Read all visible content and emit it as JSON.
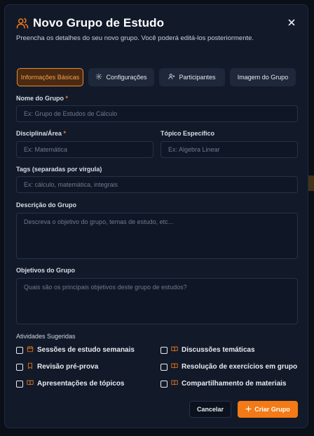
{
  "modal": {
    "title": "Novo Grupo de Estudo",
    "subtitle": "Preencha os detalhes do seu novo grupo. Você poderá editá-los posteriormente.",
    "accent_color": "#f37a16"
  },
  "tabs": [
    {
      "label": "Informações Básicas",
      "icon": "none",
      "active": true
    },
    {
      "label": "Configurações",
      "icon": "gear-icon",
      "active": false
    },
    {
      "label": "Participantes",
      "icon": "user-plus-icon",
      "active": false
    },
    {
      "label": "Imagem do Grupo",
      "icon": "none",
      "active": false
    }
  ],
  "fields": {
    "group_name": {
      "label": "Nome do Grupo",
      "required_mark": "*",
      "placeholder": "Ex: Grupo de Estudos de Cálculo",
      "value": ""
    },
    "discipline": {
      "label": "Disciplina/Área",
      "required_mark": "*",
      "placeholder": "Ex: Matemática",
      "value": ""
    },
    "topic": {
      "label": "Tópico Específico",
      "placeholder": "Ex: Algebra Linear",
      "value": ""
    },
    "tags": {
      "label": "Tags (separadas por vírgula)",
      "placeholder": "Ex: cálculo, matemática, integrais",
      "value": ""
    },
    "description": {
      "label": "Descrição do Grupo",
      "placeholder": "Descreva o objetivo do grupo, temas de estudo, etc...",
      "value": ""
    },
    "objectives": {
      "label": "Objetivos do Grupo",
      "placeholder": "Quais são os principais objetivos deste grupo de estudos?",
      "value": ""
    }
  },
  "activities": {
    "label": "Atividades Sugeridas",
    "items": [
      {
        "label": "Sessões de estudo semanais",
        "icon": "calendar-icon",
        "checked": false
      },
      {
        "label": "Discussões temáticas",
        "icon": "book-open-icon",
        "checked": false
      },
      {
        "label": "Revisão pré-prova",
        "icon": "bookmark-icon",
        "checked": false
      },
      {
        "label": "Resolução de exercícios em grupo",
        "icon": "book-open-icon",
        "checked": false
      },
      {
        "label": "Apresentações de tópicos",
        "icon": "book-open-icon",
        "checked": false
      },
      {
        "label": "Compartilhamento de materiais",
        "icon": "book-open-icon",
        "checked": false
      }
    ]
  },
  "buttons": {
    "cancel": "Cancelar",
    "create": "Criar Grupo"
  }
}
